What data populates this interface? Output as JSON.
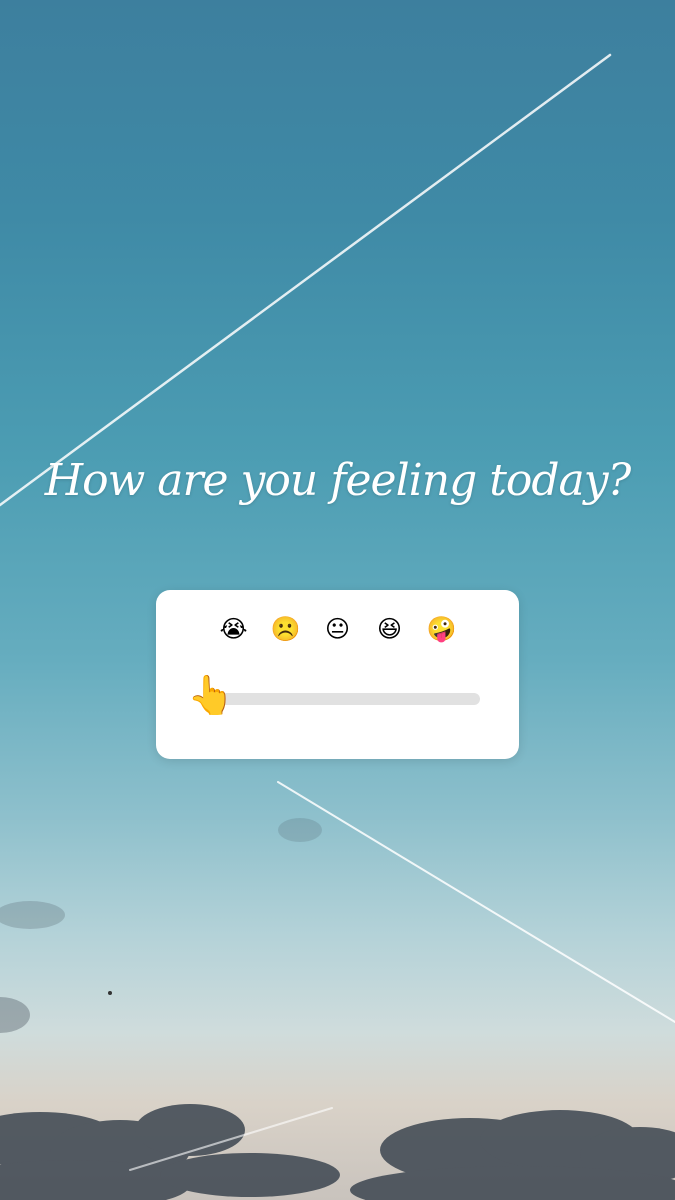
{
  "story": {
    "question": "How are you feeling today?"
  },
  "poll": {
    "emojis": [
      "😭",
      "☹️",
      "😐",
      "😆",
      "🤪"
    ],
    "emoji_names": [
      "loudly-crying-face-icon",
      "frowning-face-icon",
      "neutral-face-icon",
      "grinning-squinting-face-icon",
      "zany-face-icon"
    ],
    "slider_icon": "👆",
    "slider_value_fraction": 0.0
  },
  "colors": {
    "sky_top": "#3d7f9e",
    "sky_horizon": "#d9d2c8",
    "card_bg": "#ffffff",
    "track": "#e1e1e1"
  }
}
